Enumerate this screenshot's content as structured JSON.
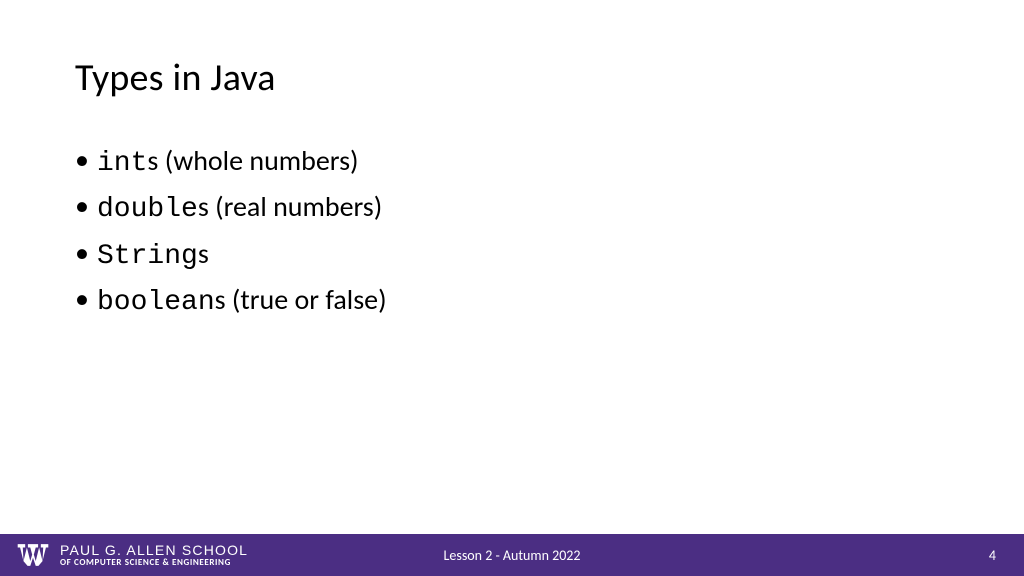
{
  "title": "Types in Java",
  "bullets": [
    {
      "code": "int",
      "text": "s (whole numbers)"
    },
    {
      "code": "double",
      "text": "s (real numbers)"
    },
    {
      "code": "String",
      "text": "s"
    },
    {
      "code": "boolean",
      "text": "s (true or false)"
    }
  ],
  "footer": {
    "school_name": "PAUL G. ALLEN SCHOOL",
    "school_dept": "OF COMPUTER SCIENCE & ENGINEERING",
    "center_text": "Lesson 2 - Autumn 2022",
    "page_number": "4"
  }
}
